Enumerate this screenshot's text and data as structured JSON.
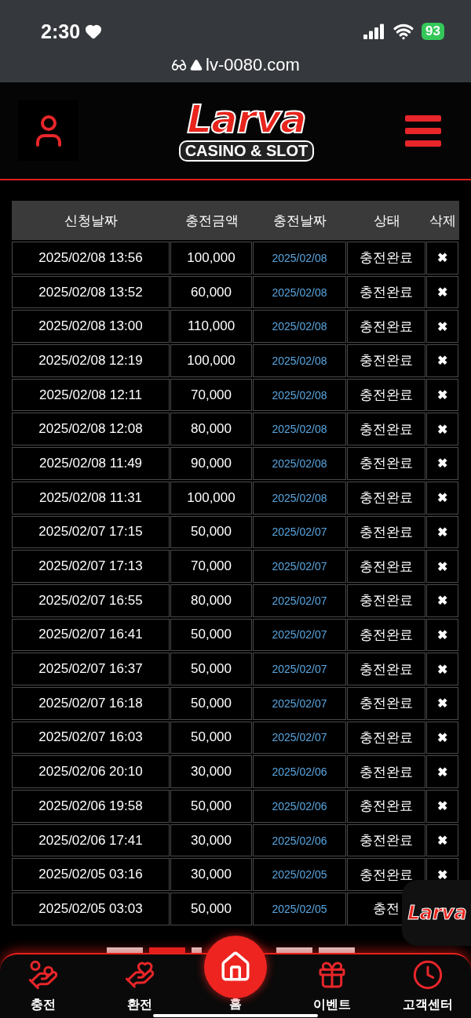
{
  "status_bar": {
    "time": "2:30",
    "battery": "93",
    "url": "lv-0080.com"
  },
  "header": {
    "logo_title": "Larva",
    "logo_subtitle": "CASINO & SLOT"
  },
  "table": {
    "columns": [
      "신청날짜",
      "충전금액",
      "충전날짜",
      "상태",
      "삭제"
    ],
    "rows": [
      {
        "requested": "2025/02/08 13:56",
        "amount": "100,000",
        "charged": "2025/02/08",
        "status": "충전완료",
        "delete": "✖"
      },
      {
        "requested": "2025/02/08 13:52",
        "amount": "60,000",
        "charged": "2025/02/08",
        "status": "충전완료",
        "delete": "✖"
      },
      {
        "requested": "2025/02/08 13:00",
        "amount": "110,000",
        "charged": "2025/02/08",
        "status": "충전완료",
        "delete": "✖"
      },
      {
        "requested": "2025/02/08 12:19",
        "amount": "100,000",
        "charged": "2025/02/08",
        "status": "충전완료",
        "delete": "✖"
      },
      {
        "requested": "2025/02/08 12:11",
        "amount": "70,000",
        "charged": "2025/02/08",
        "status": "충전완료",
        "delete": "✖"
      },
      {
        "requested": "2025/02/08 12:08",
        "amount": "80,000",
        "charged": "2025/02/08",
        "status": "충전완료",
        "delete": "✖"
      },
      {
        "requested": "2025/02/08 11:49",
        "amount": "90,000",
        "charged": "2025/02/08",
        "status": "충전완료",
        "delete": "✖"
      },
      {
        "requested": "2025/02/08 11:31",
        "amount": "100,000",
        "charged": "2025/02/08",
        "status": "충전완료",
        "delete": "✖"
      },
      {
        "requested": "2025/02/07 17:15",
        "amount": "50,000",
        "charged": "2025/02/07",
        "status": "충전완료",
        "delete": "✖"
      },
      {
        "requested": "2025/02/07 17:13",
        "amount": "70,000",
        "charged": "2025/02/07",
        "status": "충전완료",
        "delete": "✖"
      },
      {
        "requested": "2025/02/07 16:55",
        "amount": "80,000",
        "charged": "2025/02/07",
        "status": "충전완료",
        "delete": "✖"
      },
      {
        "requested": "2025/02/07 16:41",
        "amount": "50,000",
        "charged": "2025/02/07",
        "status": "충전완료",
        "delete": "✖"
      },
      {
        "requested": "2025/02/07 16:37",
        "amount": "50,000",
        "charged": "2025/02/07",
        "status": "충전완료",
        "delete": "✖"
      },
      {
        "requested": "2025/02/07 16:18",
        "amount": "50,000",
        "charged": "2025/02/07",
        "status": "충전완료",
        "delete": "✖"
      },
      {
        "requested": "2025/02/07 16:03",
        "amount": "50,000",
        "charged": "2025/02/07",
        "status": "충전완료",
        "delete": "✖"
      },
      {
        "requested": "2025/02/06 20:10",
        "amount": "30,000",
        "charged": "2025/02/06",
        "status": "충전완료",
        "delete": "✖"
      },
      {
        "requested": "2025/02/06 19:58",
        "amount": "50,000",
        "charged": "2025/02/06",
        "status": "충전완료",
        "delete": "✖"
      },
      {
        "requested": "2025/02/06 17:41",
        "amount": "30,000",
        "charged": "2025/02/06",
        "status": "충전완료",
        "delete": "✖"
      },
      {
        "requested": "2025/02/05 03:16",
        "amount": "30,000",
        "charged": "2025/02/05",
        "status": "충전완료",
        "delete": "✖"
      },
      {
        "requested": "2025/02/05 03:03",
        "amount": "50,000",
        "charged": "2025/02/05",
        "status": "충전"
      }
    ]
  },
  "pagination": [
    {
      "selected": false
    },
    {
      "selected": true
    },
    {
      "selected": false
    },
    {
      "selected": false
    },
    {
      "selected": false
    }
  ],
  "floating_badge": {
    "logo": "Larva"
  },
  "bottom_nav": [
    {
      "label": "충전",
      "kind": "normal"
    },
    {
      "label": "환전",
      "kind": "normal"
    },
    {
      "label": "홈",
      "kind": "center"
    },
    {
      "label": "이벤트",
      "kind": "normal"
    },
    {
      "label": "고객센터",
      "kind": "normal"
    }
  ]
}
